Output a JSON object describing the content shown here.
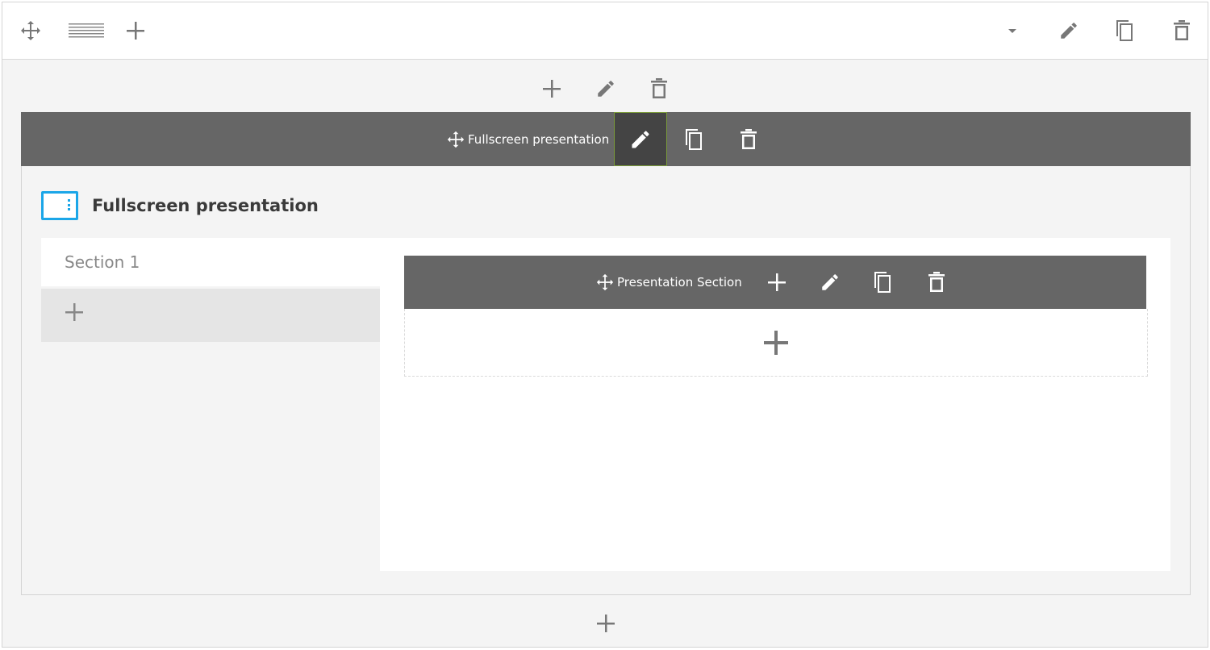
{
  "toolbar": {
    "icons": [
      "move-icon",
      "row-layout-icon",
      "plus-icon",
      "caret-down-icon",
      "pencil-icon",
      "copy-icon",
      "trash-icon"
    ]
  },
  "column_controls": {
    "icons": [
      "plus-icon",
      "pencil-icon",
      "trash-icon"
    ]
  },
  "element": {
    "bar_label": "Fullscreen presentation",
    "title": "Fullscreen presentation",
    "icon": "presentation-icon"
  },
  "presentation": {
    "nav": {
      "sections": [
        {
          "label": "Section 1"
        }
      ]
    },
    "section": {
      "bar_label": "Presentation Section"
    }
  },
  "colors": {
    "bar_bg": "#666666",
    "active_bg": "#444444",
    "accent_blue": "#1ba6e8",
    "icon_gray": "#777777",
    "frame_bg": "#f4f4f4"
  }
}
